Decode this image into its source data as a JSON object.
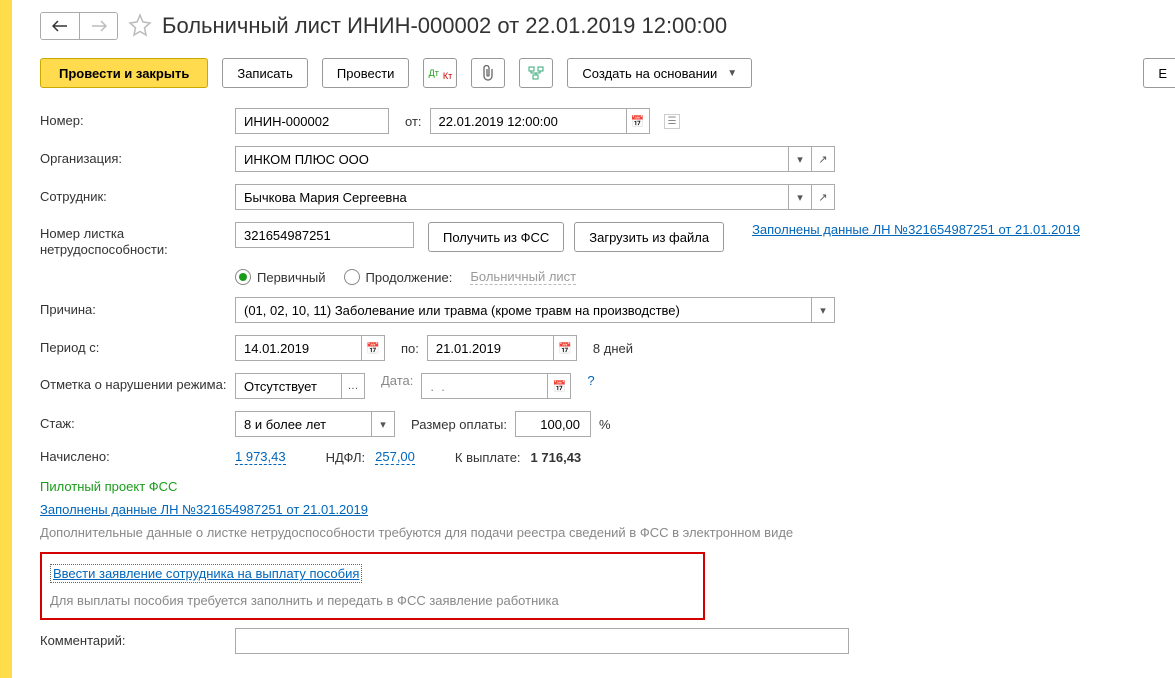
{
  "header": {
    "title": "Больничный лист ИНИН-000002 от 22.01.2019 12:00:00"
  },
  "toolbar": {
    "primary": "Провести и закрыть",
    "save": "Записать",
    "post": "Провести",
    "create_based": "Создать на основании",
    "more": "Е"
  },
  "form": {
    "number_lbl": "Номер:",
    "number": "ИНИН-000002",
    "date_lbl": "от:",
    "date": "22.01.2019 12:00:00",
    "org_lbl": "Организация:",
    "org": "ИНКОМ ПЛЮС ООО",
    "emp_lbl": "Сотрудник:",
    "emp": "Бычкова Мария Сергеевна",
    "sheet_lbl": "Номер листка нетрудоспособности:",
    "sheet": "321654987251",
    "get_fss": "Получить из ФСС",
    "load_file": "Загрузить из файла",
    "filled_link": "Заполнены данные ЛН №321654987251 от 21.01.2019",
    "radio_primary": "Первичный",
    "radio_cont": "Продолжение:",
    "cont_placeholder": "Больничный лист",
    "reason_lbl": "Причина:",
    "reason": "(01, 02, 10, 11) Заболевание или травма (кроме травм на производстве)",
    "period_lbl": "Период с:",
    "period_from": "14.01.2019",
    "period_to_lbl": "по:",
    "period_to": "21.01.2019",
    "days": "8 дней",
    "violation_lbl": "Отметка о нарушении режима:",
    "violation": "Отсутствует",
    "violation_date_lbl": "Дата:",
    "violation_date": ".  .",
    "help": "?",
    "seniority_lbl": "Стаж:",
    "seniority": "8 и более лет",
    "pay_size_lbl": "Размер оплаты:",
    "pay_size": "100,00",
    "percent": "%",
    "accrued_lbl": "Начислено:",
    "accrued": "1 973,43",
    "tax_lbl": "НДФЛ:",
    "tax": "257,00",
    "payout_lbl": "К выплате:",
    "payout": "1 716,43"
  },
  "footer": {
    "pilot": "Пилотный проект ФСС",
    "filled_link": "Заполнены данные ЛН №321654987251 от 21.01.2019",
    "note1": "Дополнительные данные о листке нетрудоспособности требуются для подачи реестра сведений в ФСС в электронном виде",
    "box_link": "Ввести заявление сотрудника на выплату пособия",
    "box_note": "Для выплаты пособия требуется заполнить и передать в ФСС заявление работника",
    "comment_lbl": "Комментарий:"
  }
}
